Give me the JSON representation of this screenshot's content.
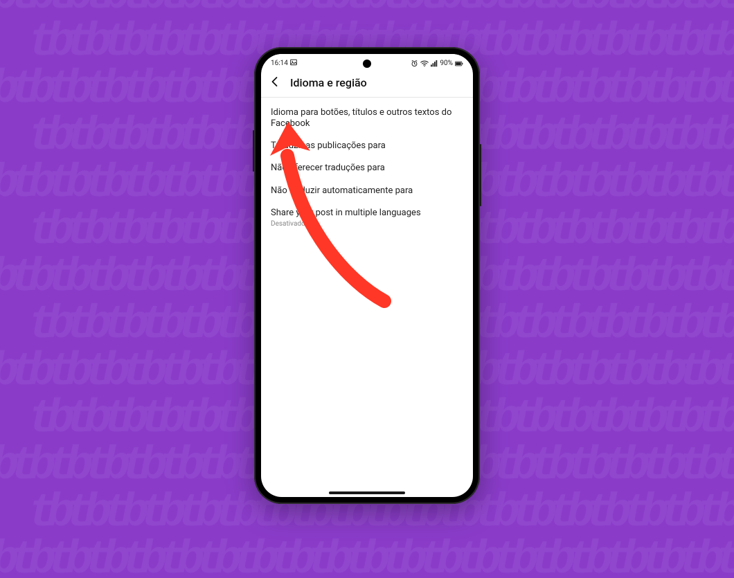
{
  "background": {
    "watermark_unit": "tb",
    "base_color": "#8a3cc9",
    "pattern_color": "#9a55d4"
  },
  "status_bar": {
    "time": "16:14",
    "left_icons": [
      "picture-icon"
    ],
    "right_icons": [
      "alarm-icon",
      "wifi-icon",
      "signal-icon"
    ],
    "battery_text": "90%"
  },
  "header": {
    "back_icon": "chevron-left-icon",
    "title": "Idioma e região"
  },
  "settings": [
    {
      "label": "Idioma para botões, títulos e outros textos do Facebook",
      "sub": ""
    },
    {
      "label": "Traduzir as publicações para",
      "sub": ""
    },
    {
      "label": "Não oferecer traduções para",
      "sub": ""
    },
    {
      "label": "Não traduzir automaticamente para",
      "sub": ""
    },
    {
      "label": "Share your post in multiple languages",
      "sub": "Desativado"
    }
  ],
  "annotation": {
    "description": "red-arrow-pointing-to-first-setting",
    "color": "#ff3726"
  }
}
